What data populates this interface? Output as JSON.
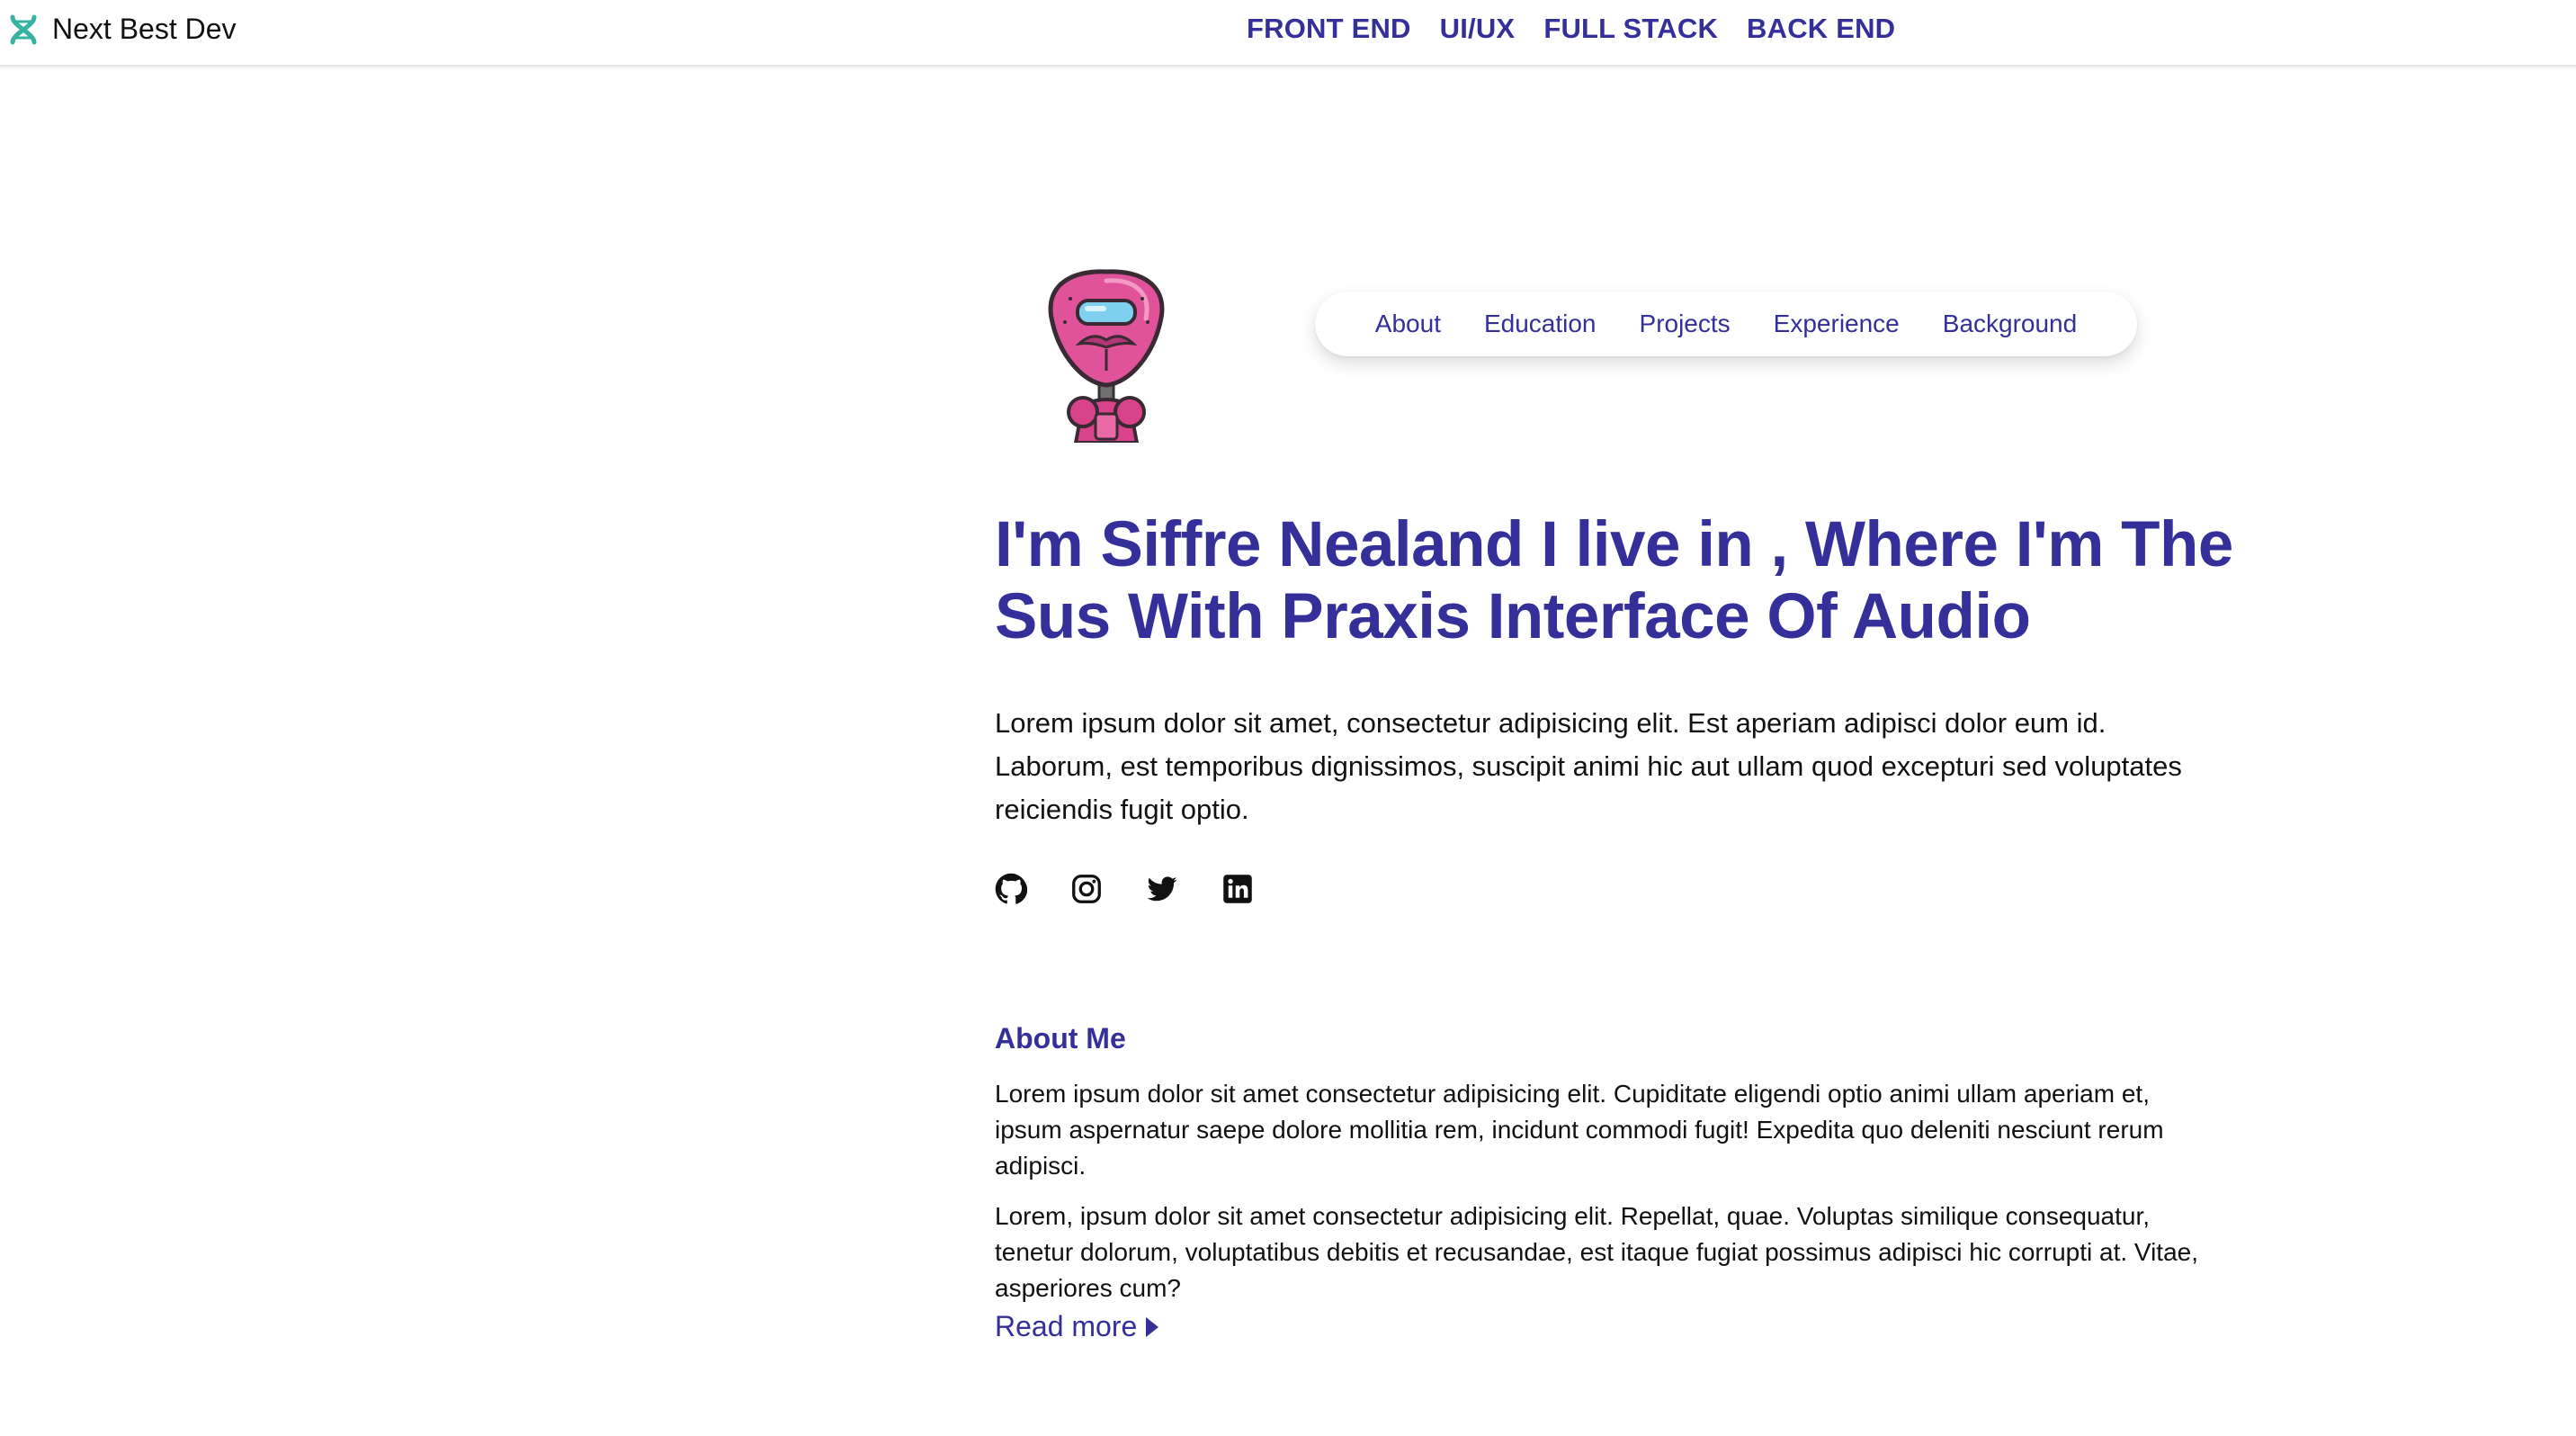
{
  "brand": {
    "name": "Next Best Dev",
    "logo_icon": "dna-logo-icon",
    "logo_color": "#35b3a0"
  },
  "top_nav": {
    "items": [
      "FRONT END",
      "UI/UX",
      "FULL STACK",
      "BACK END"
    ]
  },
  "section_nav": {
    "items": [
      "About",
      "Education",
      "Projects",
      "Experience",
      "Background"
    ]
  },
  "hero": {
    "avatar_icon": "robot-avatar",
    "title": "I'm Siffre Nealand I live in , Where I'm The Sus With Praxis Interface Of Audio",
    "description": "Lorem ipsum dolor sit amet, consectetur adipisicing elit. Est aperiam adipisci dolor eum id. Laborum, est temporibus dignissimos, suscipit animi hic aut ullam quod excepturi sed voluptates reiciendis fugit optio."
  },
  "socials": [
    "github-icon",
    "instagram-icon",
    "twitter-icon",
    "linkedin-icon"
  ],
  "about": {
    "heading": "About Me",
    "paragraph1": "Lorem ipsum dolor sit amet consectetur adipisicing elit. Cupiditate eligendi optio animi ullam aperiam et, ipsum aspernatur saepe dolore mollitia rem, incidunt commodi fugit! Expedita quo deleniti nesciunt rerum adipisci.",
    "paragraph2": "Lorem, ipsum dolor sit amet consectetur adipisicing elit. Repellat, quae. Voluptas similique consequatur, tenetur dolorum, voluptatibus debitis et recusandae, est itaque fugiat possimus adipisci hic corrupti at. Vitae, asperiores cum?",
    "read_more": "Read more"
  },
  "colors": {
    "accent": "#352f9a",
    "text": "#111111",
    "avatar_pink": "#e0529a"
  }
}
